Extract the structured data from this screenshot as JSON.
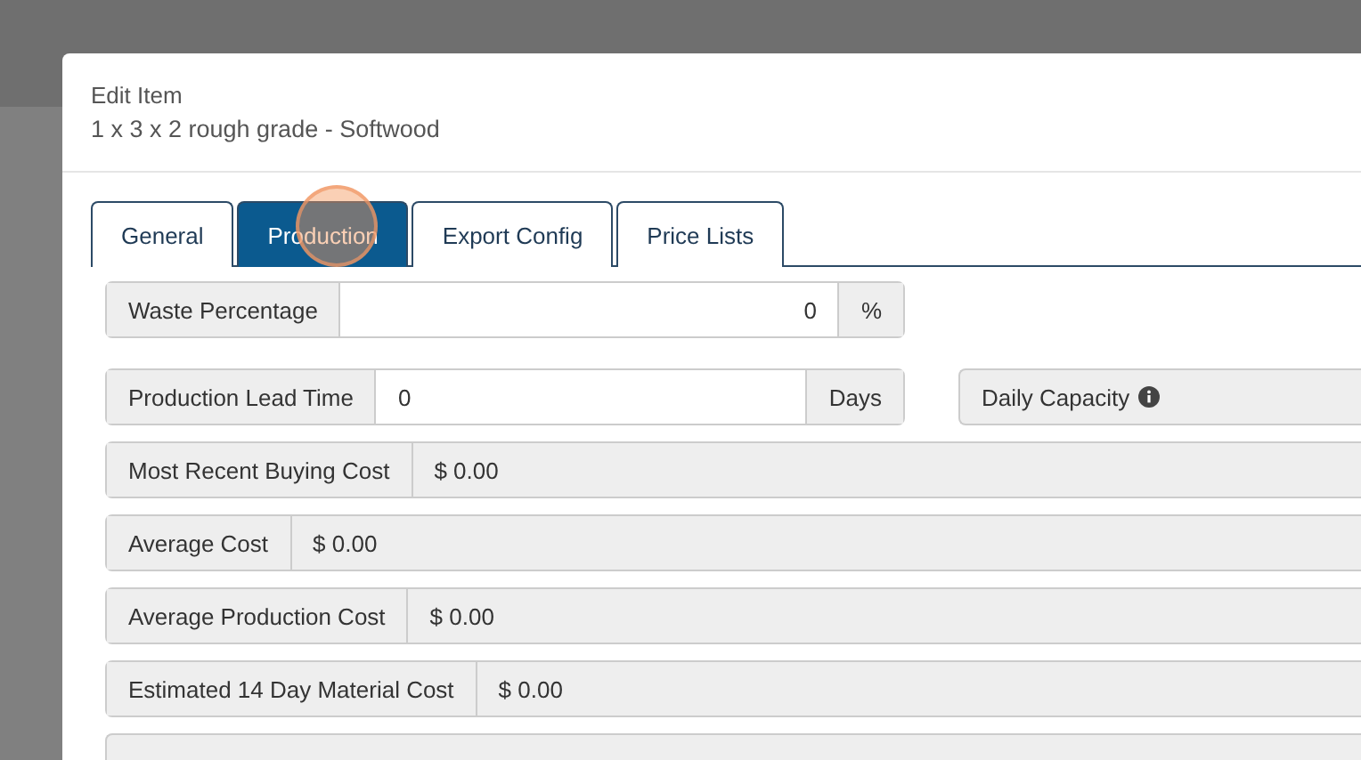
{
  "dialog": {
    "title": "Edit Item",
    "subtitle": "1 x 3 x 2 rough grade - Softwood"
  },
  "tabs": [
    {
      "label": "General",
      "selected": false
    },
    {
      "label": "Production",
      "selected": true
    },
    {
      "label": "Export Config",
      "selected": false
    },
    {
      "label": "Price Lists",
      "selected": false
    }
  ],
  "waste": {
    "label": "Waste Percentage",
    "value": "0",
    "unit": "%"
  },
  "lead_time": {
    "label": "Production Lead Time",
    "value": "0",
    "unit": "Days"
  },
  "daily_capacity": {
    "label": "Daily Capacity"
  },
  "costs": [
    {
      "label": "Most Recent Buying Cost",
      "value": "$ 0.00"
    },
    {
      "label": "Average Cost",
      "value": "$ 0.00"
    },
    {
      "label": "Average Production Cost",
      "value": "$ 0.00"
    },
    {
      "label": "Estimated 14 Day Material Cost",
      "value": "$ 0.00"
    }
  ]
}
